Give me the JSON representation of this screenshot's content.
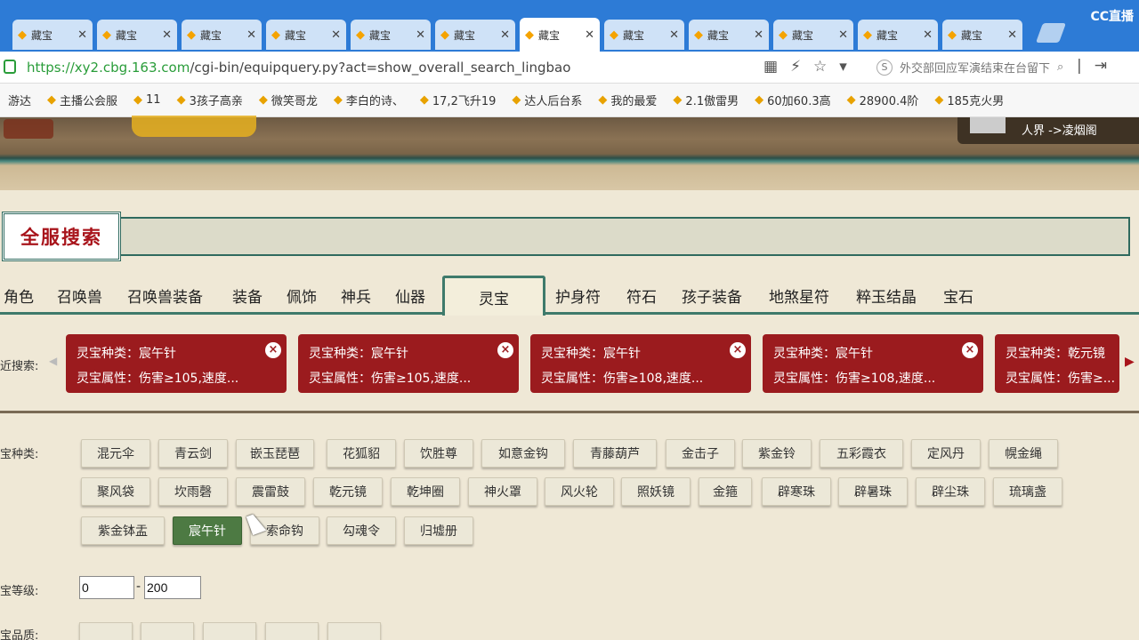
{
  "browser": {
    "tabs": [
      {
        "title": "藏宝"
      },
      {
        "title": "藏宝"
      },
      {
        "title": "藏宝"
      },
      {
        "title": "藏宝"
      },
      {
        "title": "藏宝"
      },
      {
        "title": "藏宝"
      },
      {
        "title": "藏宝"
      },
      {
        "title": "藏宝"
      },
      {
        "title": "藏宝"
      },
      {
        "title": "藏宝"
      },
      {
        "title": "藏宝"
      },
      {
        "title": "藏宝"
      }
    ],
    "active_tab_index": 6,
    "badge": "CC直播",
    "url_host": "https://xy2.cbg.163.com",
    "url_path": "/cgi-bin/equipquery.py?act=show_overall_search_lingbao",
    "search_text": "外交部回应军演结束在台留下",
    "bookmarks": [
      "游达",
      "主播公会服",
      "11",
      "3孩子高亲",
      "微笑哥龙",
      "李白的诗、",
      "17,2飞升19",
      "达人后台系",
      "我的最爱",
      "2.1傲雷男",
      "60加60.3高",
      "28900.4阶",
      "185克火男"
    ]
  },
  "header": {
    "user_location": "人界 ->凌烟阁"
  },
  "search": {
    "title": "全服搜索",
    "categories": [
      "角色",
      "召唤兽",
      "召唤兽装备",
      "装备",
      "佩饰",
      "神兵",
      "仙器",
      "灵宝",
      "护身符",
      "符石",
      "孩子装备",
      "地煞星符",
      "粹玉结晶",
      "宝石"
    ],
    "active_category": "灵宝",
    "recent_label": "近搜索:",
    "recent": [
      {
        "line1": "灵宝种类：宸午针",
        "line2": "灵宝属性：伤害≥105,速度..."
      },
      {
        "line1": "灵宝种类：宸午针",
        "line2": "灵宝属性：伤害≥105,速度..."
      },
      {
        "line1": "灵宝种类：宸午针",
        "line2": "灵宝属性：伤害≥108,速度..."
      },
      {
        "line1": "灵宝种类：宸午针",
        "line2": "灵宝属性：伤害≥108,速度..."
      },
      {
        "line1": "灵宝种类：乾元镜",
        "line2": "灵宝属性：伤害≥..."
      }
    ],
    "kind_label": "宝种类:",
    "kinds": [
      "混元伞",
      "青云剑",
      "嵌玉琵琶",
      "花狐貂",
      "饮胜尊",
      "如意金钩",
      "青藤葫芦",
      "金击子",
      "紫金铃",
      "五彩霞衣",
      "定风丹",
      "幌金绳",
      "聚风袋",
      "坎雨磬",
      "震雷鼓",
      "乾元镜",
      "乾坤圈",
      "神火罩",
      "风火轮",
      "照妖镜",
      "金箍",
      "辟寒珠",
      "辟暑珠",
      "辟尘珠",
      "琉璃盏",
      "紫金钵盂",
      "宸午针",
      "索命钩",
      "勾魂令",
      "归墟册"
    ],
    "selected_kind": "宸午针",
    "level_label": "宝等级:",
    "level_min": "0",
    "level_max": "200",
    "quality_label": "宝品质:"
  }
}
